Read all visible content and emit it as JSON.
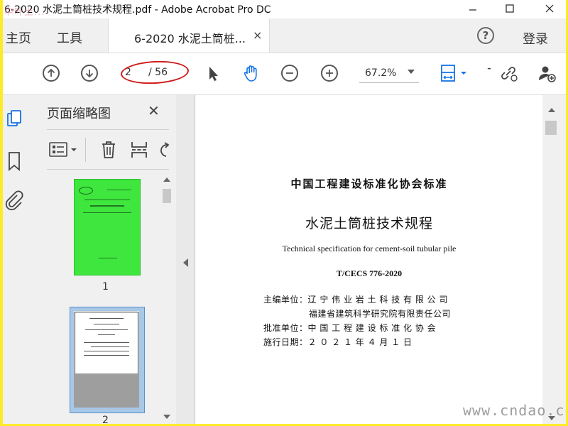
{
  "window": {
    "title": "6-2020 水泥土筒桩技术规程.pdf - Adobe Acrobat Pro DC",
    "watermark_top": "中叶土...",
    "controls": [
      "minimize",
      "maximize",
      "close"
    ]
  },
  "tabs": {
    "home": "主页",
    "tools": "工具",
    "document": "6-2020 水泥土筒桩...",
    "close_glyph": "×",
    "help_glyph": "?",
    "login": "登录"
  },
  "toolbar": {
    "current_page": "2",
    "total_pages": "/ 56",
    "zoom": "67.2%",
    "icons": [
      "prev-page-icon",
      "next-page-icon",
      "select-tool-icon",
      "hand-tool-icon",
      "zoom-out-icon",
      "zoom-in-icon",
      "page-fit-icon",
      "link-icon",
      "add-user-icon"
    ]
  },
  "rail": {
    "icons": [
      "page-thumbnails-icon",
      "bookmark-icon",
      "attachment-icon"
    ]
  },
  "panel": {
    "title": "页面缩略图",
    "close_glyph": "✕",
    "tools": [
      "thumbnail-options-icon",
      "delete-icon",
      "insert-page-icon",
      "rotate-icon"
    ],
    "thumbnails": [
      {
        "number": "1",
        "color": "#3ee63e"
      },
      {
        "number": "2",
        "selected": true
      }
    ]
  },
  "document": {
    "header": "中国工程建设标准化协会标准",
    "title": "水泥土筒桩技术规程",
    "title_en": "Technical specification for cement-soil tubular pile",
    "code": "T/CECS 776-2020",
    "rows": [
      {
        "label": "主编单位：",
        "value": "辽 宁 伟 业 岩 土 科 技 有 限 公 司"
      },
      {
        "label": "",
        "value": "福建省建筑科学研究院有限责任公司"
      },
      {
        "label": "批准单位：",
        "value": "中 国 工 程 建 设 标 准 化 协 会"
      },
      {
        "label": "施行日期：",
        "value": "２ ０ ２ １  年  ４  月  １  日"
      }
    ]
  },
  "watermark_bottom": "www.cndao.com",
  "colors": {
    "frame_border": "#fdeb2a",
    "accent_blue": "#1473e6",
    "annotation_red": "#d01a1a",
    "thumbnail_green": "#3ee63e"
  }
}
